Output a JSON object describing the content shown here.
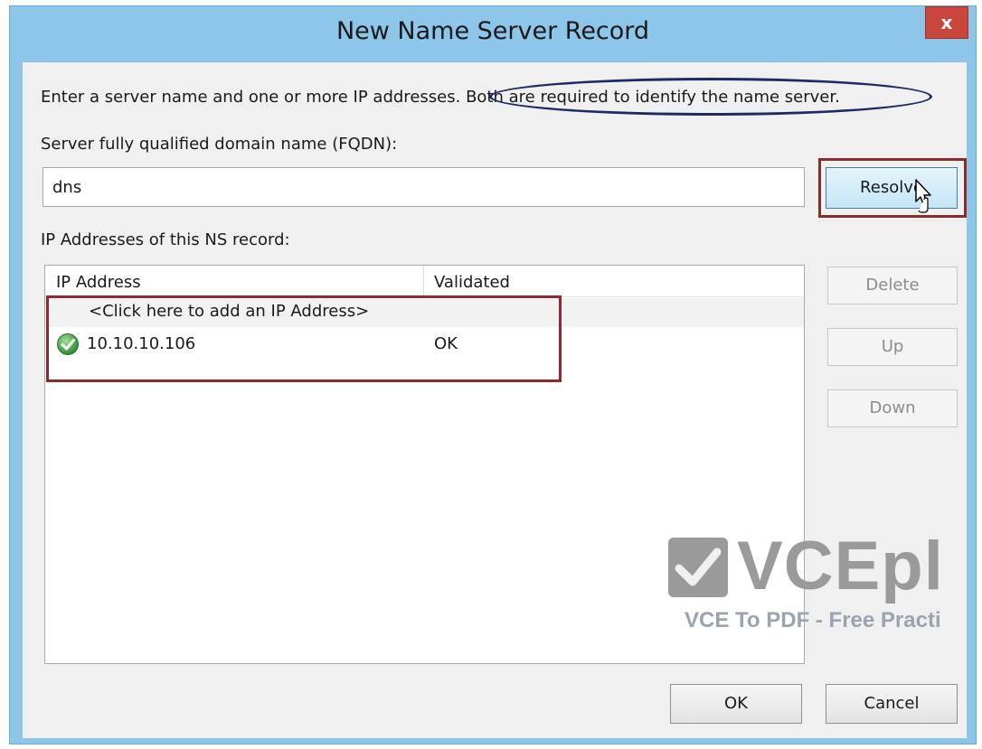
{
  "dialog": {
    "title": "New Name Server Record",
    "close_label": "x"
  },
  "form": {
    "instructions_part1": "Enter a server name and one or more IP addresses.",
    "instructions_part2": "Both are required to identify the name server.",
    "fqdn_label": "Server fully qualified domain name (FQDN):",
    "fqdn_value": "dns",
    "resolve_label": "Resolve",
    "ip_section_label": "IP Addresses of this NS record:"
  },
  "ip_list": {
    "columns": [
      "IP Address",
      "Validated"
    ],
    "add_row_text": "<Click here to add an IP Address>",
    "rows": [
      {
        "ip": "10.10.10.106",
        "validated": "OK",
        "icon": "check-circle-icon"
      }
    ]
  },
  "side_buttons": {
    "delete_label": "Delete",
    "up_label": "Up",
    "down_label": "Down"
  },
  "footer": {
    "ok_label": "OK",
    "cancel_label": "Cancel"
  },
  "watermark": {
    "logo_text": "VCEpl",
    "tagline": "VCE To PDF - Free Practi"
  },
  "colors": {
    "window_frame": "#8ec6ea",
    "close_button": "#c9463c",
    "annotation_box": "#8b2b2b",
    "annotation_ellipse": "#1e2a64",
    "check_green": "#3aa33a"
  }
}
